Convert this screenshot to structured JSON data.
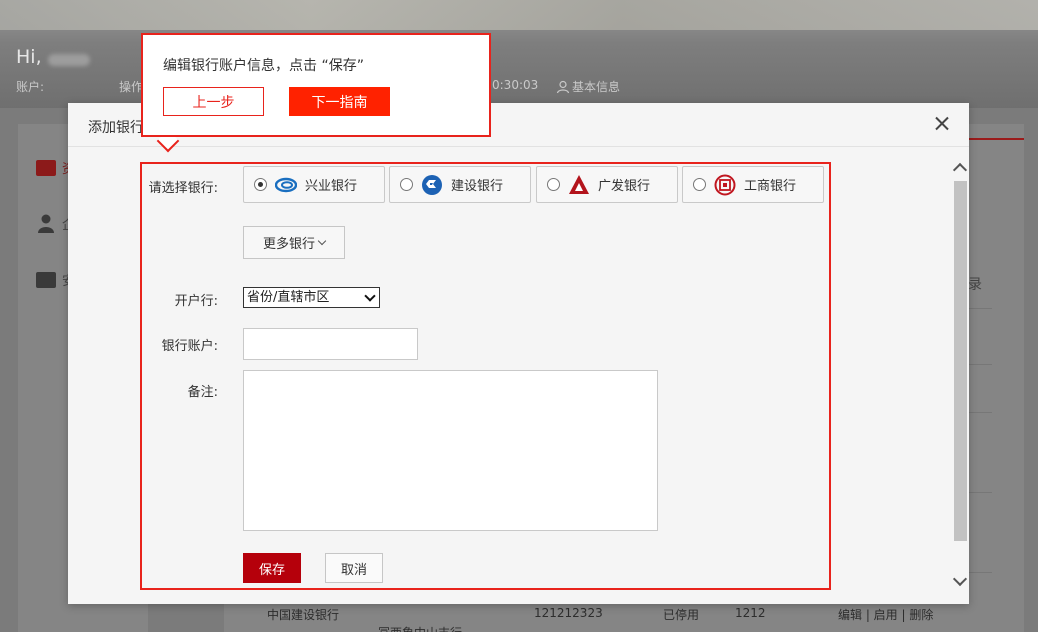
{
  "background": {
    "greeting": "Hi,",
    "meta": {
      "account_label": "账户:",
      "operation_label": "操作",
      "time": "0:30:03",
      "basic_info": "基本信息"
    },
    "sidebar": [
      {
        "label": "资",
        "icon": "card-icon"
      },
      {
        "label": "企",
        "icon": "user-icon"
      },
      {
        "label": "安",
        "icon": "card-icon"
      }
    ],
    "right_label": "录",
    "row": {
      "bank": "中国建设银行",
      "account": "121212323",
      "status": "已停用",
      "remark": "1212",
      "actions": "编辑 | 启用 | 删除"
    },
    "row2_text": "冨西象中山支行"
  },
  "modal": {
    "title": "添加银行",
    "form": {
      "bank_label": "请选择银行:",
      "banks": [
        {
          "name": "兴业银行",
          "checked": true,
          "icon": "cib-logo-icon"
        },
        {
          "name": "建设银行",
          "checked": false,
          "icon": "ccb-logo-icon"
        },
        {
          "name": "广发银行",
          "checked": false,
          "icon": "cgb-logo-icon"
        },
        {
          "name": "工商银行",
          "checked": false,
          "icon": "icbc-logo-icon"
        }
      ],
      "more_banks": "更多银行",
      "branch_label": "开户行:",
      "branch_value": "省份/直辖市区",
      "account_label": "银行账户:",
      "account_value": "",
      "remark_label": "备注:",
      "remark_value": "",
      "save": "保存",
      "cancel": "取消"
    }
  },
  "guide": {
    "text": "编辑银行账户信息，点击 “保存”",
    "prev": "上一步",
    "next": "下一指南"
  },
  "colors": {
    "accent": "#e8231c",
    "save_button": "#b5000b",
    "next_button": "#ff2200"
  }
}
